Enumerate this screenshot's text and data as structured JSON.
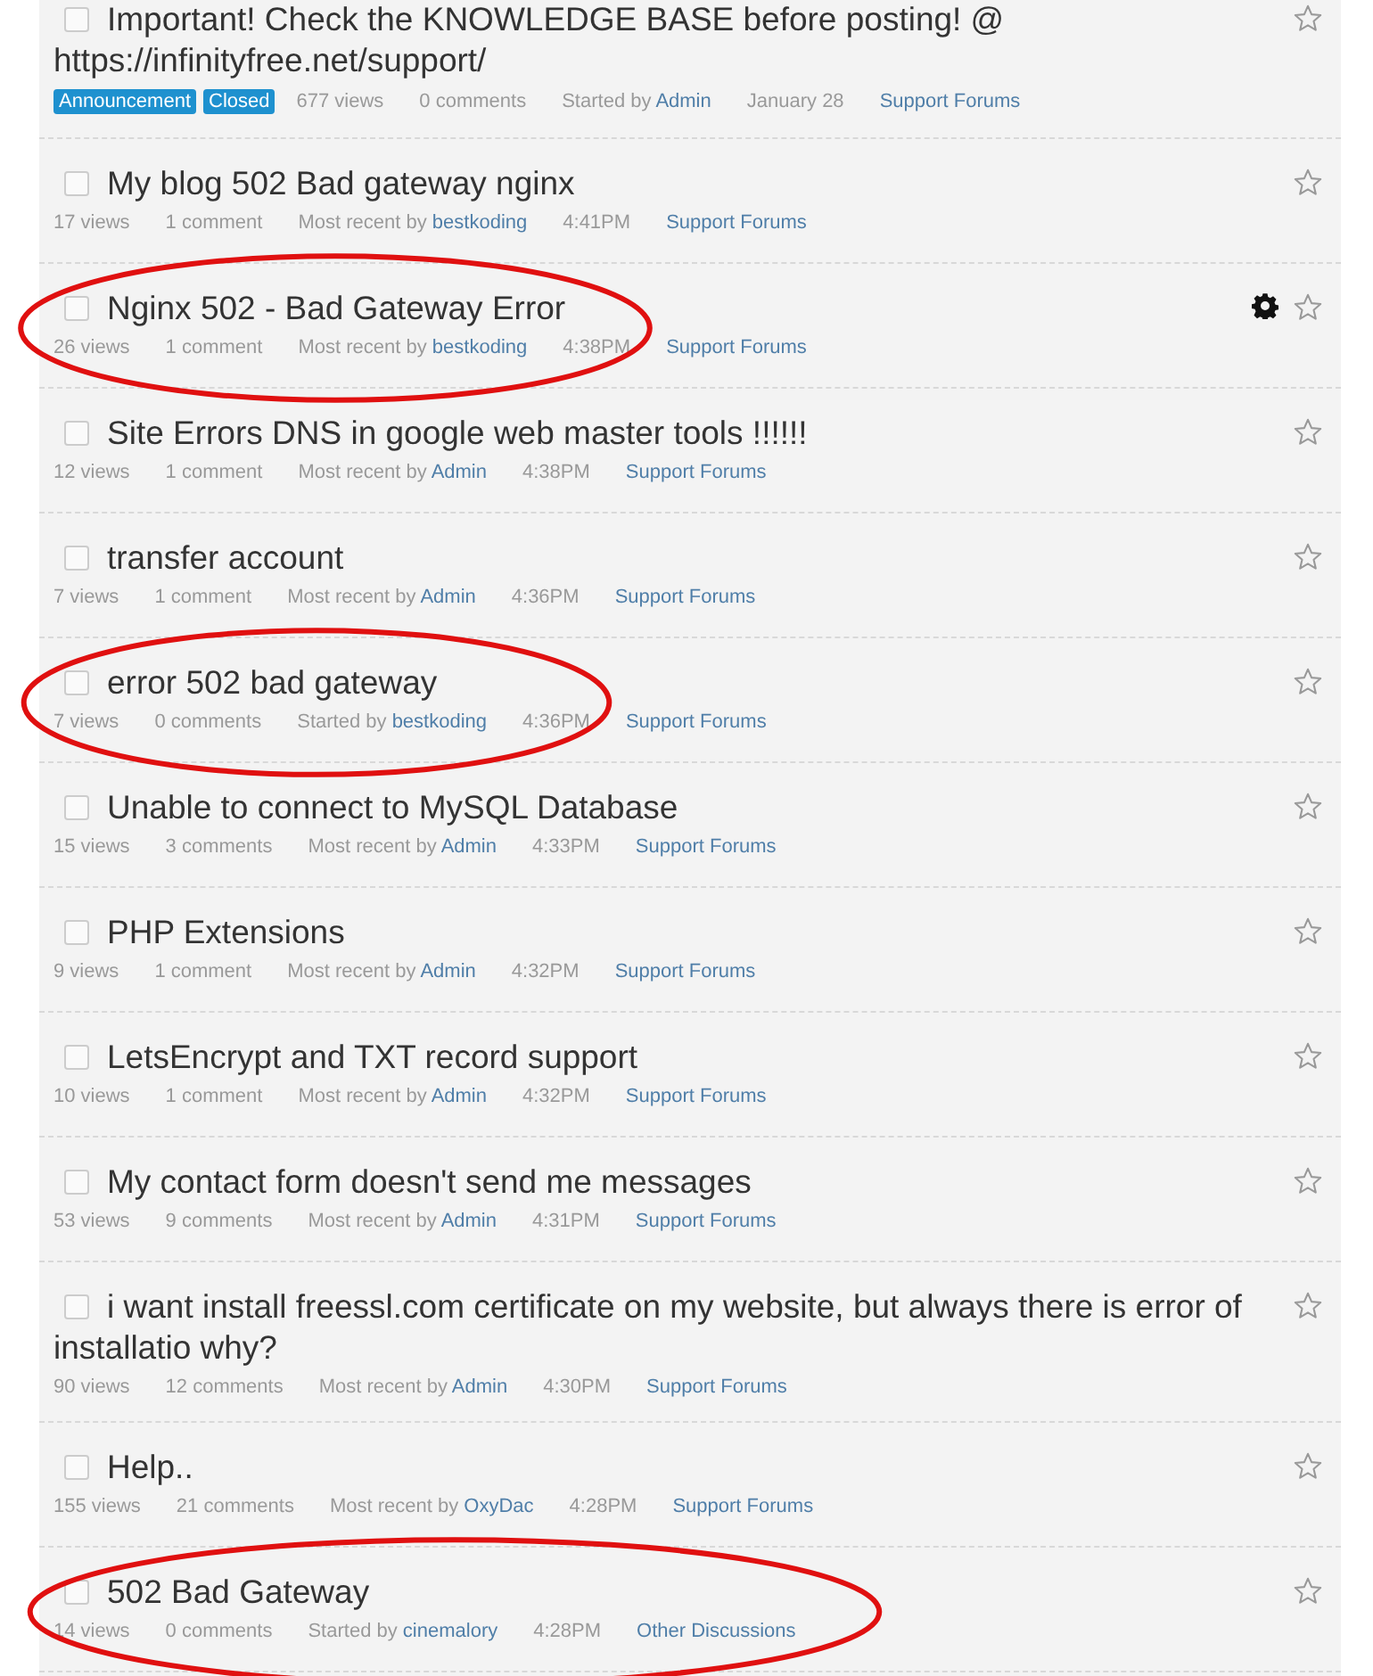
{
  "discussions": [
    {
      "title": "Important! Check the KNOWLEDGE BASE before posting! @ https://infinityfree.net/support/",
      "tags": [
        "Announcement",
        "Closed"
      ],
      "views": "677 views",
      "comments": "0 comments",
      "by_label": "Started by",
      "author": "Admin",
      "time": "January 28",
      "category": "Support Forums",
      "gear": false,
      "circled": false,
      "checked": false
    },
    {
      "title": "My blog 502 Bad gateway nginx",
      "views": "17 views",
      "comments": "1 comment",
      "by_label": "Most recent by",
      "author": "bestkoding",
      "time": "4:41PM",
      "category": "Support Forums",
      "gear": false,
      "circled": false,
      "checked": false
    },
    {
      "title": "Nginx 502 - Bad Gateway Error",
      "views": "26 views",
      "comments": "1 comment",
      "by_label": "Most recent by",
      "author": "bestkoding",
      "time": "4:38PM",
      "category": "Support Forums",
      "gear": true,
      "circled": true,
      "checked": false
    },
    {
      "title": "Site Errors DNS in google web master tools !!!!!!",
      "views": "12 views",
      "comments": "1 comment",
      "by_label": "Most recent by",
      "author": "Admin",
      "time": "4:38PM",
      "category": "Support Forums",
      "gear": false,
      "circled": false,
      "checked": false
    },
    {
      "title": "transfer account",
      "views": "7 views",
      "comments": "1 comment",
      "by_label": "Most recent by",
      "author": "Admin",
      "time": "4:36PM",
      "category": "Support Forums",
      "gear": false,
      "circled": false,
      "checked": false
    },
    {
      "title": "error 502 bad gateway",
      "views": "7 views",
      "comments": "0 comments",
      "by_label": "Started by",
      "author": "bestkoding",
      "time": "4:36PM",
      "category": "Support Forums",
      "gear": false,
      "circled": true,
      "checked": false
    },
    {
      "title": "Unable to connect to MySQL Database",
      "views": "15 views",
      "comments": "3 comments",
      "by_label": "Most recent by",
      "author": "Admin",
      "time": "4:33PM",
      "category": "Support Forums",
      "gear": false,
      "circled": false,
      "checked": false
    },
    {
      "title": "PHP Extensions",
      "views": "9 views",
      "comments": "1 comment",
      "by_label": "Most recent by",
      "author": "Admin",
      "time": "4:32PM",
      "category": "Support Forums",
      "gear": false,
      "circled": false,
      "checked": false
    },
    {
      "title": "LetsEncrypt and TXT record support",
      "views": "10 views",
      "comments": "1 comment",
      "by_label": "Most recent by",
      "author": "Admin",
      "time": "4:32PM",
      "category": "Support Forums",
      "gear": false,
      "circled": false,
      "checked": false
    },
    {
      "title": "My contact form doesn't send me messages",
      "views": "53 views",
      "comments": "9 comments",
      "by_label": "Most recent by",
      "author": "Admin",
      "time": "4:31PM",
      "category": "Support Forums",
      "gear": false,
      "circled": false,
      "checked": false
    },
    {
      "title": "i want install freessl.com certificate on my website, but always there is error of installatio why?",
      "views": "90 views",
      "comments": "12 comments",
      "by_label": "Most recent by",
      "author": "Admin",
      "time": "4:30PM",
      "category": "Support Forums",
      "gear": false,
      "circled": false,
      "checked": false
    },
    {
      "title": "Help..",
      "views": "155 views",
      "comments": "21 comments",
      "by_label": "Most recent by",
      "author": "OxyDac",
      "time": "4:28PM",
      "category": "Support Forums",
      "gear": false,
      "circled": false,
      "checked": false
    },
    {
      "title": "502 Bad Gateway",
      "views": "14 views",
      "comments": "0 comments",
      "by_label": "Started by",
      "author": "cinemalory",
      "time": "4:28PM",
      "category": "Other Discussions",
      "gear": false,
      "circled": true,
      "checked": false
    }
  ]
}
